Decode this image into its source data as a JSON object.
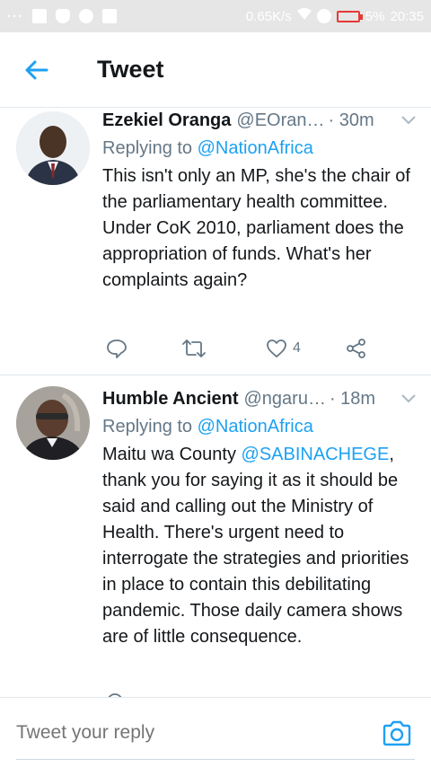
{
  "status_bar": {
    "left_dots": "···",
    "network_speed": "0.65K/s",
    "battery_percent": "5%",
    "time": "20:35"
  },
  "header": {
    "title": "Tweet",
    "back_icon": "arrow-left-icon",
    "accent_color": "#1da1f2"
  },
  "tweets": [
    {
      "name": "Ezekiel Oranga",
      "handle": "@EOran…",
      "time": "· 30m",
      "replying_prefix": "Replying to ",
      "replying_to": "@NationAfrica",
      "text": "This isn't only an MP, she's the chair of the parliamentary health committee. Under CoK 2010, parliament does the appropriation of funds. What's her complaints again?",
      "like_count": "4"
    },
    {
      "name": "Humble Ancient",
      "handle": "@ngaru…",
      "time": "· 18m",
      "replying_prefix": "Replying to ",
      "replying_to": "@NationAfrica",
      "text_prefix": "Maitu wa County ",
      "text_mention": "@SABINACHEGE",
      "text_rest": ", thank you for saying it as it should be said and calling out the Ministry of Health. There's urgent need to interrogate the strategies and priorities in place to contain this debilitating pandemic. Those daily camera shows are of little consequence."
    }
  ],
  "reply_bar": {
    "placeholder": "Tweet your reply",
    "camera_icon": "camera-icon"
  }
}
